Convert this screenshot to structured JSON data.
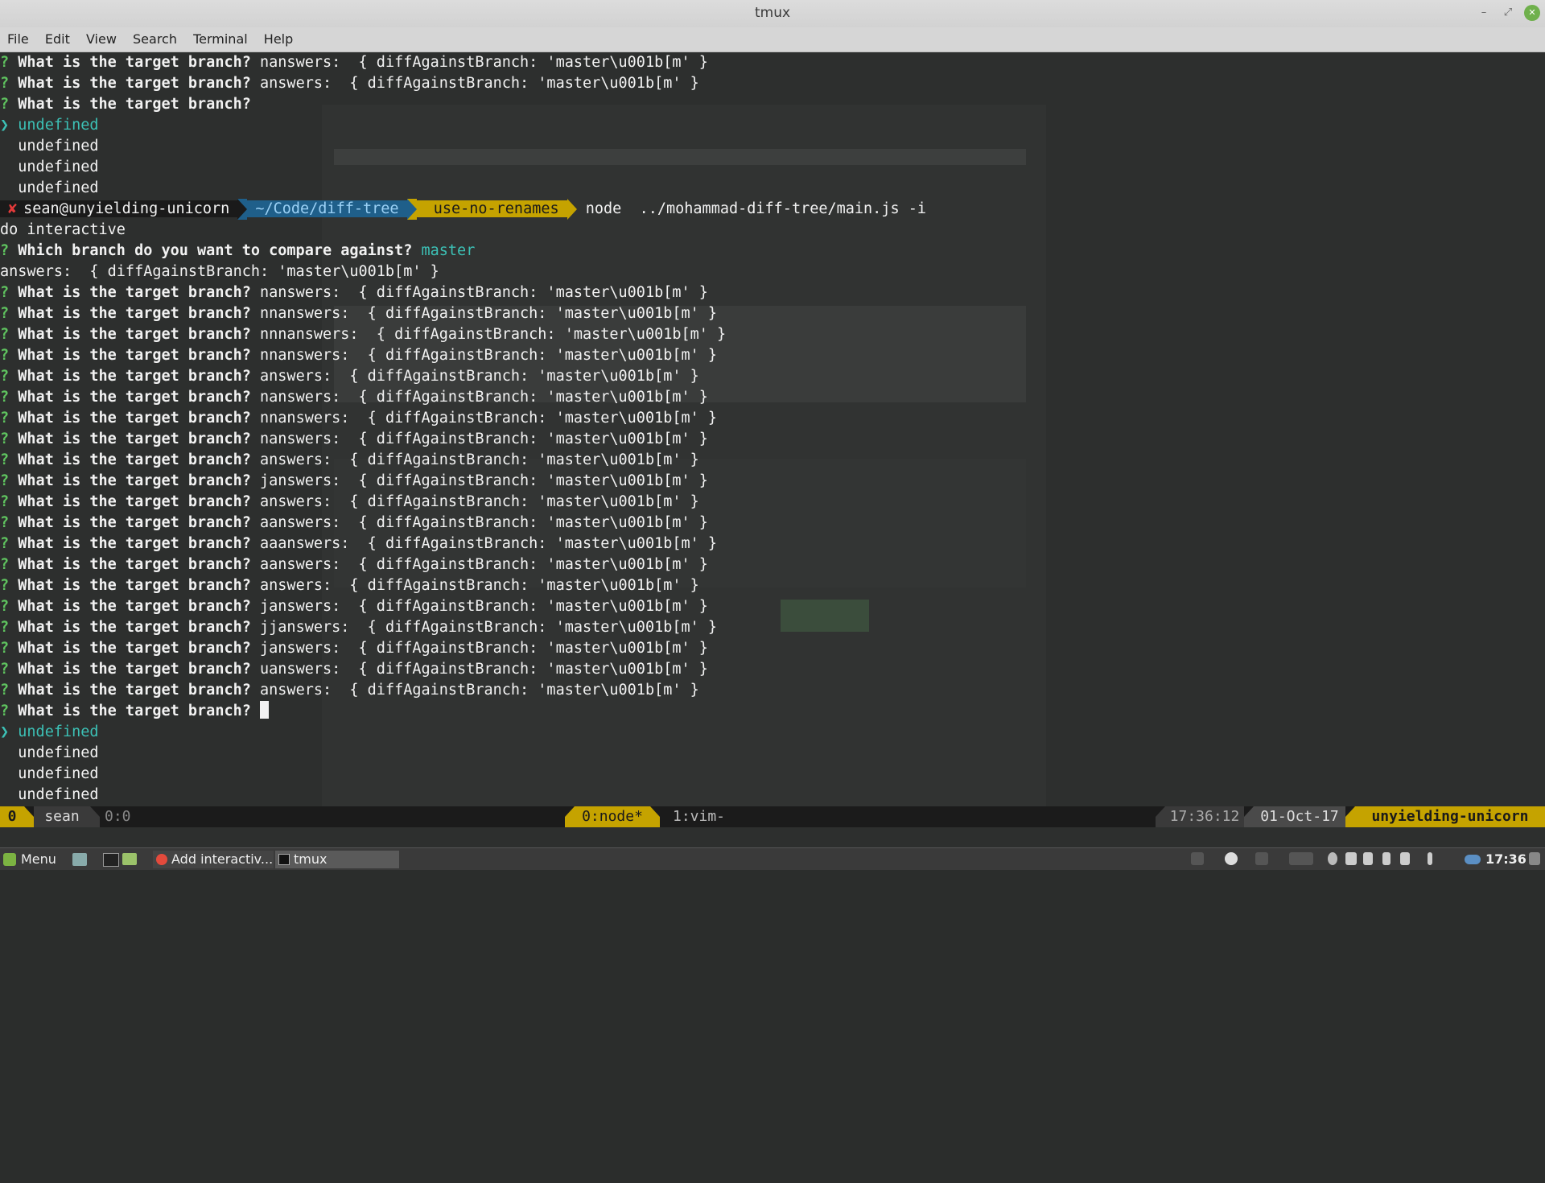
{
  "window": {
    "title": "tmux"
  },
  "menu": [
    "File",
    "Edit",
    "View",
    "Search",
    "Terminal",
    "Help"
  ],
  "terminal": {
    "top_lines": [
      {
        "q": "? ",
        "prompt": "What is the target branch? ",
        "rest": "nanswers:  { diffAgainstBranch: 'master\\u001b[m' }"
      },
      {
        "q": "? ",
        "prompt": "What is the target branch? ",
        "rest": "answers:  { diffAgainstBranch: 'master\\u001b[m' }"
      },
      {
        "q": "? ",
        "prompt": "What is the target branch? ",
        "rest": ""
      }
    ],
    "undef1": [
      "undefined",
      "undefined",
      "undefined",
      "undefined"
    ],
    "powerline": {
      "x_mark": "✘",
      "user": "sean@unyielding-unicorn",
      "path": "~/Code/diff-tree",
      "branch_icon": "",
      "branch": "use-no-renames",
      "command": "node  ../mohammad-diff-tree/main.js -i"
    },
    "do_interactive": "do interactive",
    "which_prompt": "Which branch do you want to compare against? ",
    "which_answer": "master",
    "answers_line": "answers:  { diffAgainstBranch: 'master\\u001b[m' }",
    "repeat_prompt": "What is the target branch? ",
    "repeat_rest": [
      "nanswers:  { diffAgainstBranch: 'master\\u001b[m' }",
      "nnanswers:  { diffAgainstBranch: 'master\\u001b[m' }",
      "nnnanswers:  { diffAgainstBranch: 'master\\u001b[m' }",
      "nnanswers:  { diffAgainstBranch: 'master\\u001b[m' }",
      "answers:  { diffAgainstBranch: 'master\\u001b[m' }",
      "nanswers:  { diffAgainstBranch: 'master\\u001b[m' }",
      "nnanswers:  { diffAgainstBranch: 'master\\u001b[m' }",
      "nanswers:  { diffAgainstBranch: 'master\\u001b[m' }",
      "answers:  { diffAgainstBranch: 'master\\u001b[m' }",
      "janswers:  { diffAgainstBranch: 'master\\u001b[m' }",
      "answers:  { diffAgainstBranch: 'master\\u001b[m' }",
      "aanswers:  { diffAgainstBranch: 'master\\u001b[m' }",
      "aaanswers:  { diffAgainstBranch: 'master\\u001b[m' }",
      "aanswers:  { diffAgainstBranch: 'master\\u001b[m' }",
      "answers:  { diffAgainstBranch: 'master\\u001b[m' }",
      "janswers:  { diffAgainstBranch: 'master\\u001b[m' }",
      "jjanswers:  { diffAgainstBranch: 'master\\u001b[m' }",
      "janswers:  { diffAgainstBranch: 'master\\u001b[m' }",
      "uanswers:  { diffAgainstBranch: 'master\\u001b[m' }",
      "answers:  { diffAgainstBranch: 'master\\u001b[m' }"
    ],
    "final_prompt": "What is the target branch? ",
    "undef2": [
      "undefined",
      "undefined",
      "undefined",
      "undefined"
    ]
  },
  "tmux_status": {
    "session": "0",
    "user": "sean",
    "pane": "0:0",
    "win_active": "0:node*",
    "win_other": "1:vim-",
    "time": "17:36:12",
    "date": "01-Oct-17",
    "host": "unyielding-unicorn"
  },
  "taskbar": {
    "menu_label": "Menu",
    "task1": "Add interactiv...",
    "task2": "tmux",
    "clock": "17:36"
  },
  "colors": {
    "prompt_q": "#5fc35f",
    "cyan": "#3cc0b5",
    "path_bg": "#1f5f8a",
    "branch_bg": "#c5a300",
    "tmux_yellow": "#c5a300"
  }
}
